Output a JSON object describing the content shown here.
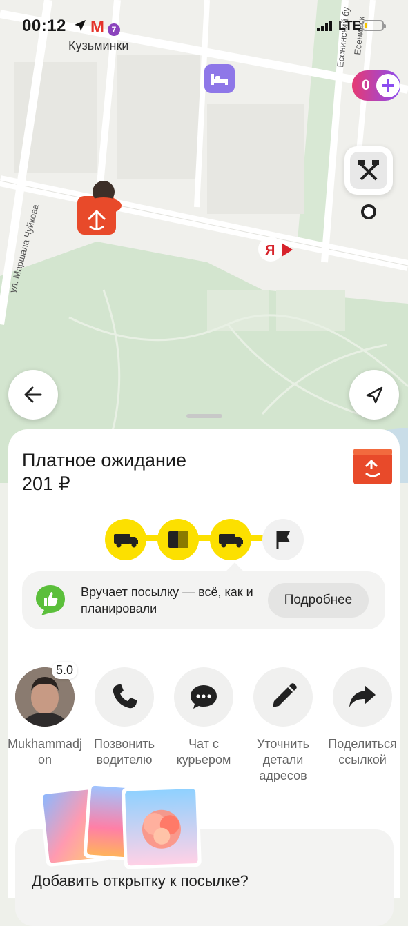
{
  "status_bar": {
    "time": "00:12",
    "metro_letter": "М",
    "metro_line": "7",
    "station": "Кузьминки",
    "network": "LTE"
  },
  "map": {
    "street_label": "ул. Маршала Чуйкова",
    "street_label_2": "Есенинский бу",
    "street_label_3": "Есенинск",
    "yandex_letter": "Я",
    "plus_count": "0"
  },
  "order": {
    "title": "Платное ожидание",
    "price": "201 ₽"
  },
  "info": {
    "text": "Вручает посылку — всё, как и планировали",
    "more_button": "Подробнее"
  },
  "actions": [
    {
      "label": "Mukhammadjon",
      "rating": "5.0"
    },
    {
      "label": "Позвонить водителю"
    },
    {
      "label": "Чат с курьером"
    },
    {
      "label": "Уточнить детали адресов"
    },
    {
      "label": "Поделиться ссылкой"
    }
  ],
  "postcard": {
    "title": "Добавить открытку к посылке?"
  },
  "colors": {
    "accent": "#fce000",
    "brand_red": "#e84a2a",
    "map_park": "#d6e8d2"
  }
}
